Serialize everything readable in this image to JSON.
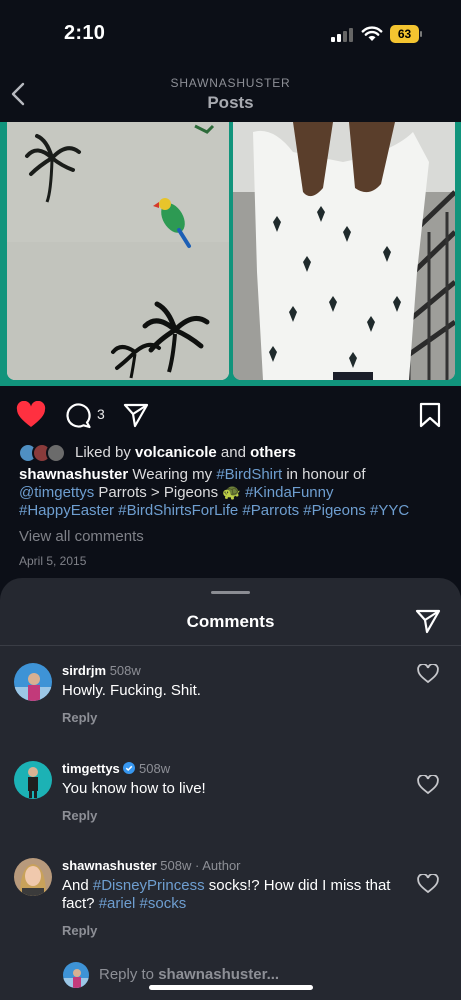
{
  "status_bar": {
    "time": "2:10",
    "battery": "63"
  },
  "header": {
    "username": "SHAWNASHUSTER",
    "title": "Posts"
  },
  "post": {
    "comment_count": "3",
    "likes": {
      "prefix": "Liked by ",
      "user": "volcanicole",
      "middle": " and ",
      "others": "others"
    },
    "caption": {
      "username": "shawnashuster",
      "text1": " Wearing my ",
      "tag1": "#BirdShirt",
      "text2": " in honour of ",
      "mention": "@timgettys",
      "text3": " Parrots > Pigeons 🐢 ",
      "tag2": "#KindaFunny",
      "tags_line": "#HappyEaster #BirdShirtsForLife #Parrots #Pigeons #YYC"
    },
    "view_comments": "View all comments",
    "date": "April 5, 2015"
  },
  "sheet": {
    "title": "Comments",
    "comments": [
      {
        "user": "sirdrjm",
        "time": "508w",
        "text": "Howly. Fucking. Shit.",
        "reply": "Reply"
      },
      {
        "user": "timgettys",
        "time": "508w",
        "text": "You know how to live!",
        "reply": "Reply"
      },
      {
        "user": "shawnashuster",
        "time": "508w",
        "author": "· Author",
        "text1": "And ",
        "tag1": "#DisneyPrincess",
        "text2": " socks!? How did I miss that fact? ",
        "tag2": "#ariel",
        "text3": " ",
        "tag3": "#socks",
        "reply": "Reply"
      }
    ],
    "reply_prefix": "Reply to ",
    "reply_user": "shawnashuster..."
  },
  "colors": {
    "accent_green": "#11947c",
    "like_red": "#ff3040",
    "link_blue": "#6e9ed0",
    "verified_blue": "#3797f0"
  }
}
